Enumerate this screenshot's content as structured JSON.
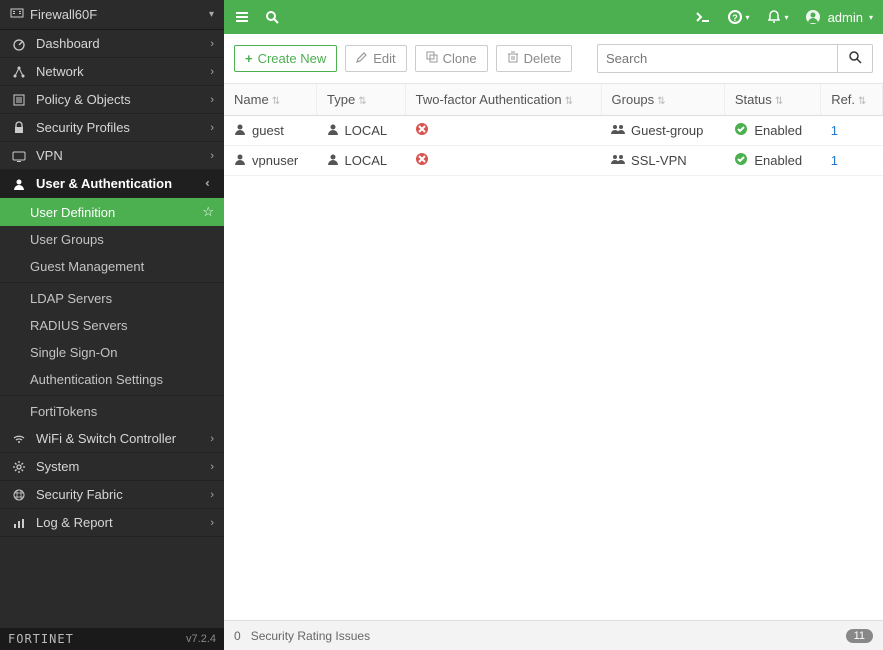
{
  "device_name": "Firewall60F",
  "admin_label": "admin",
  "version": "v7.2.4",
  "brand": "FORTINET",
  "nav": {
    "dashboard": "Dashboard",
    "network": "Network",
    "policy": "Policy & Objects",
    "security": "Security Profiles",
    "vpn": "VPN",
    "user_auth": "User & Authentication",
    "wifi": "WiFi & Switch Controller",
    "system": "System",
    "fabric": "Security Fabric",
    "log": "Log & Report"
  },
  "subnav": {
    "user_def": "User Definition",
    "user_groups": "User Groups",
    "guest_mgmt": "Guest Management",
    "ldap": "LDAP Servers",
    "radius": "RADIUS Servers",
    "sso": "Single Sign-On",
    "auth_settings": "Authentication Settings",
    "fortitokens": "FortiTokens"
  },
  "toolbar": {
    "create": "Create New",
    "edit": "Edit",
    "clone": "Clone",
    "delete": "Delete",
    "search_placeholder": "Search"
  },
  "columns": {
    "name": "Name",
    "type": "Type",
    "two_factor": "Two-factor Authentication",
    "groups": "Groups",
    "status": "Status",
    "ref": "Ref."
  },
  "rows": [
    {
      "name": "guest",
      "type": "LOCAL",
      "two_factor": "disabled",
      "group": "Guest-group",
      "status": "Enabled",
      "ref": "1"
    },
    {
      "name": "vpnuser",
      "type": "LOCAL",
      "two_factor": "disabled",
      "group": "SSL-VPN",
      "status": "Enabled",
      "ref": "1"
    }
  ],
  "footer": {
    "issues_label": "Security Rating Issues",
    "issues_count": "0",
    "badge": "11"
  }
}
